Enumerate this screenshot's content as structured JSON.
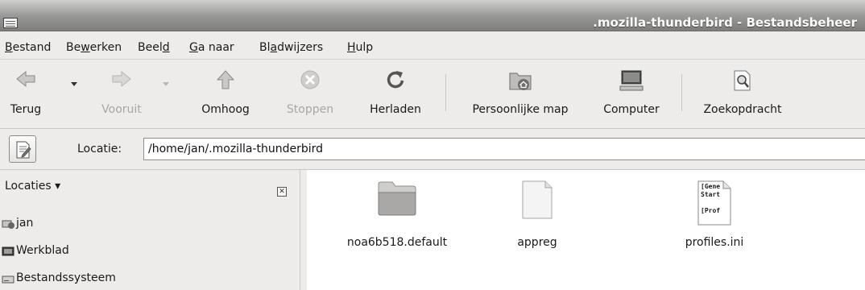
{
  "window": {
    "title": ".mozilla-thunderbird - Bestandsbeheer"
  },
  "menubar": {
    "items": [
      {
        "label": "Bestand",
        "mnemonic": "B"
      },
      {
        "label": "Bewerken",
        "mnemonic": "w"
      },
      {
        "label": "Beeld",
        "mnemonic": "d"
      },
      {
        "label": "Ga naar",
        "mnemonic": "G"
      },
      {
        "label": "Bladwijzers",
        "mnemonic": "a"
      },
      {
        "label": "Hulp",
        "mnemonic": "H"
      }
    ]
  },
  "toolbar": {
    "back_label": "Terug",
    "forward_label": "Vooruit",
    "up_label": "Omhoog",
    "stop_label": "Stoppen",
    "reload_label": "Herladen",
    "home_label": "Persoonlijke map",
    "computer_label": "Computer",
    "search_label": "Zoekopdracht"
  },
  "location": {
    "label": "Locatie:",
    "value": "/home/jan/.mozilla-thunderbird"
  },
  "sidebar": {
    "header": "Locaties",
    "header_arrow": "▾",
    "close_glyph": "✕",
    "items": [
      {
        "label": "jan",
        "icon": "home-drive-icon"
      },
      {
        "label": "Werkblad",
        "icon": "desktop-icon"
      },
      {
        "label": "Bestandssysteem",
        "icon": "drive-icon"
      }
    ]
  },
  "files": [
    {
      "name": "noa6b518.default",
      "type": "folder",
      "icon": "folder-icon"
    },
    {
      "name": "appreg",
      "type": "file",
      "icon": "document-icon"
    },
    {
      "name": "profiles.ini",
      "type": "text-file",
      "icon": "text-file-icon",
      "preview_lines": [
        "[Gene",
        "Start",
        "[Prof"
      ]
    }
  ],
  "colors": {
    "window_bg": "#edeceb",
    "content_bg": "#ffffff",
    "disabled_text": "#a8a7a5",
    "title_text": "#ffffff"
  }
}
